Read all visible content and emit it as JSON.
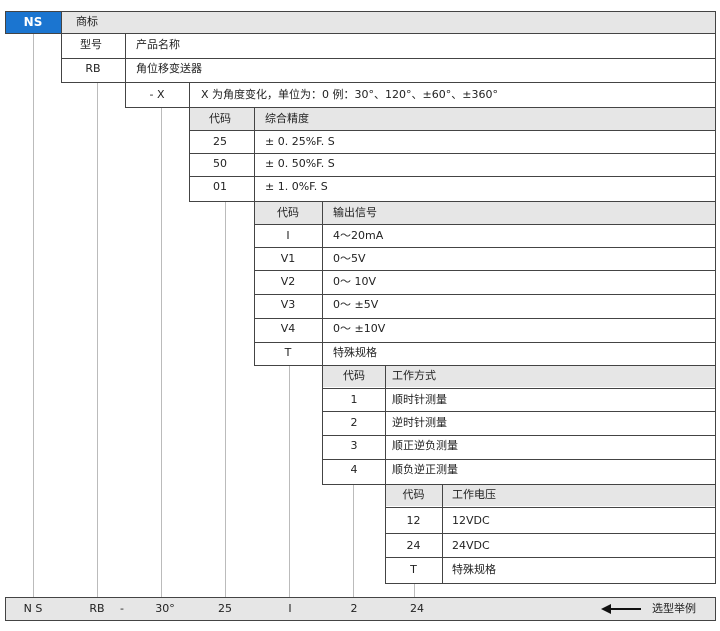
{
  "brand": {
    "code": "NS",
    "label": "商标"
  },
  "model_row": {
    "label": "型号",
    "name_label": "产品名称"
  },
  "product": {
    "code": "RB",
    "name": "角位移变送器"
  },
  "angle": {
    "code": "- X",
    "desc": "X 为角度变化，单位为：0 例：30°、120°、±60°、±360°"
  },
  "accuracy": {
    "header_code": "代码",
    "header_name": "综合精度",
    "rows": [
      {
        "code": "25",
        "value": "± 0. 25%F. S"
      },
      {
        "code": "50",
        "value": "± 0. 50%F. S"
      },
      {
        "code": "01",
        "value": "± 1. 0%F. S"
      }
    ]
  },
  "output": {
    "header_code": "代码",
    "header_name": "输出信号",
    "rows": [
      {
        "code": "I",
        "value": "4～20mA"
      },
      {
        "code": "V1",
        "value": "0～5V"
      },
      {
        "code": "V2",
        "value": "0～ 10V"
      },
      {
        "code": "V3",
        "value": "0～ ±5V"
      },
      {
        "code": "V4",
        "value": "0～ ±10V"
      },
      {
        "code": "T",
        "value": "特殊规格"
      }
    ]
  },
  "mode": {
    "header_code": "代码",
    "header_name": "工作方式",
    "rows": [
      {
        "code": "1",
        "value": "顺时针测量"
      },
      {
        "code": "2",
        "value": "逆时针测量"
      },
      {
        "code": "3",
        "value": "顺正逆负测量"
      },
      {
        "code": "4",
        "value": "顺负逆正测量"
      }
    ]
  },
  "voltage": {
    "header_code": "代码",
    "header_name": "工作电压",
    "rows": [
      {
        "code": "12",
        "value": "12VDC"
      },
      {
        "code": "24",
        "value": "24VDC"
      },
      {
        "code": "T",
        "value": "特殊规格"
      }
    ]
  },
  "example": {
    "parts": [
      "N S",
      "RB",
      "-",
      "30°",
      "25",
      "I",
      "2",
      "24"
    ],
    "label": "选型举例",
    "arrow_icon": "left-arrow-icon"
  }
}
